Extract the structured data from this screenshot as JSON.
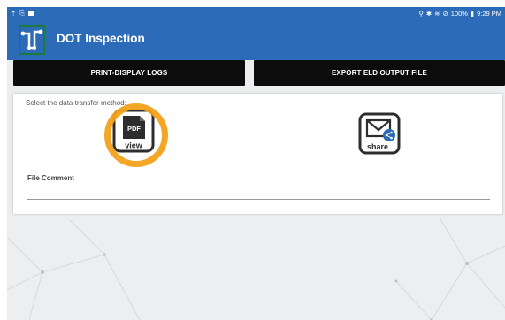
{
  "status_bar": {
    "right_text": "100%",
    "time": "9:29 PM"
  },
  "app": {
    "title": "DOT Inspection",
    "brand_color": "#2c6bb7"
  },
  "buttons": {
    "print": "PRINT-DISPLAY LOGS",
    "export": "EXPORT ELD OUTPUT FILE"
  },
  "card": {
    "prompt": "Select the data transfer method:",
    "pdf_label": "PDF",
    "view_label": "view",
    "share_label": "share",
    "file_comment_label": "File Comment",
    "file_comment_value": ""
  },
  "colors": {
    "highlight": "#f3a21b",
    "share_badge": "#2c6bb7"
  }
}
